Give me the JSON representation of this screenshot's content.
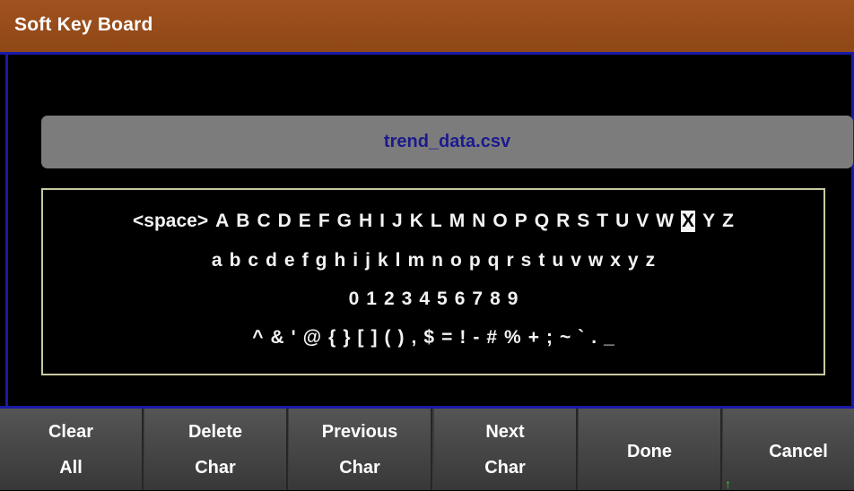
{
  "window": {
    "title": "Soft Key Board"
  },
  "input": {
    "value": "trend_data.csv"
  },
  "keyboard": {
    "row1": [
      "<space>",
      "A",
      "B",
      "C",
      "D",
      "E",
      "F",
      "G",
      "H",
      "I",
      "J",
      "K",
      "L",
      "M",
      "N",
      "O",
      "P",
      "Q",
      "R",
      "S",
      "T",
      "U",
      "V",
      "W",
      "X",
      "Y",
      "Z"
    ],
    "row2": [
      "a",
      "b",
      "c",
      "d",
      "e",
      "f",
      "g",
      "h",
      "i",
      "j",
      "k",
      "l",
      "m",
      "n",
      "o",
      "p",
      "q",
      "r",
      "s",
      "t",
      "u",
      "v",
      "w",
      "x",
      "y",
      "z"
    ],
    "row3": [
      "0",
      "1",
      "2",
      "3",
      "4",
      "5",
      "6",
      "7",
      "8",
      "9"
    ],
    "row4": [
      "^",
      "&",
      "'",
      "@",
      "{",
      "}",
      "[",
      "]",
      "(",
      ")",
      ",",
      "$",
      "=",
      "!",
      "-",
      "#",
      "%",
      "+",
      ";",
      "~",
      "`",
      ".",
      "_"
    ],
    "selected": "X"
  },
  "toolbar": {
    "clear_all": [
      "Clear",
      "All"
    ],
    "delete_char": [
      "Delete",
      "Char"
    ],
    "previous_char": [
      "Previous",
      "Char"
    ],
    "next_char": [
      "Next",
      "Char"
    ],
    "done": "Done",
    "cancel": "Cancel"
  },
  "icons": {
    "cursor_arrow": "up-arrow-icon"
  },
  "colors": {
    "title_bar": "#94491a",
    "frame": "#1a1aa6",
    "input_bg": "#7c7c7c",
    "input_text": "#1b1b8e",
    "key_border": "#c9c9a0"
  }
}
